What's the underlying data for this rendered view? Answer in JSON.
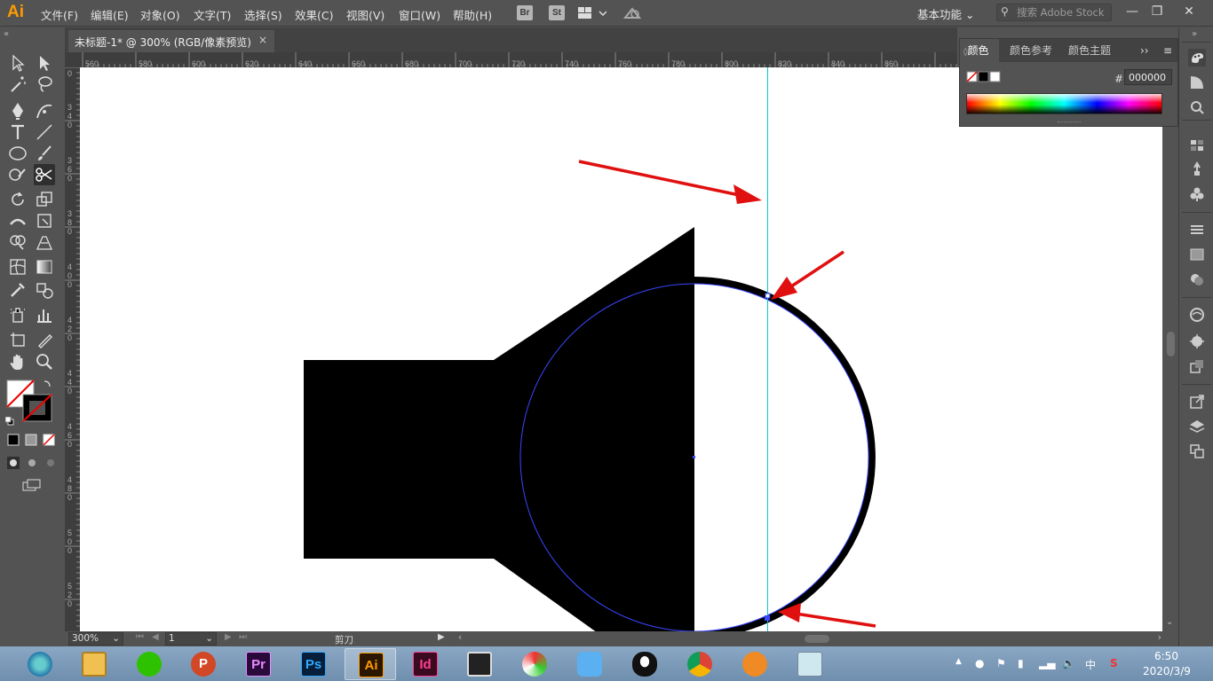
{
  "app": {
    "logo": "Ai"
  },
  "menu": {
    "items": [
      "文件(F)",
      "编辑(E)",
      "对象(O)",
      "文字(T)",
      "选择(S)",
      "效果(C)",
      "视图(V)",
      "窗口(W)",
      "帮助(H)"
    ],
    "bridge": "Br",
    "stock": "St",
    "workspace": "基本功能",
    "search_placeholder": "搜索 Adobe Stock"
  },
  "document": {
    "tab_title": "未标题-1* @ 300% (RGB/像素预览)",
    "close": "×"
  },
  "ruler": {
    "top_labels": [
      "560",
      "580",
      "600",
      "620",
      "640",
      "660",
      "680",
      "700",
      "720",
      "740",
      "760",
      "780",
      "800",
      "820",
      "840",
      "860"
    ],
    "left_labels": [
      "0",
      "340",
      "360",
      "380",
      "400",
      "420",
      "440",
      "460",
      "480",
      "500",
      "520"
    ]
  },
  "statusbar": {
    "zoom": "300%",
    "artboard": "1",
    "current_tool": "剪刀"
  },
  "color_panel": {
    "tabs": [
      "颜色",
      "颜色参考",
      "颜色主题"
    ],
    "hex_label": "#",
    "hex_value": "000000"
  },
  "taskbar": {
    "apps": [
      "360-browser",
      "file-explorer",
      "wechat",
      "powerpoint",
      "premiere",
      "photoshop",
      "illustrator",
      "indesign",
      "video-editor",
      "colorful-app",
      "chat-app",
      "qq",
      "chrome",
      "foxmail",
      "notes"
    ],
    "labels": {
      "powerpoint": "P",
      "premiere": "Pr",
      "photoshop": "Ps",
      "illustrator": "Ai",
      "indesign": "Id"
    },
    "ime": "中",
    "time": "6:50",
    "date": "2020/3/9"
  },
  "colors": {
    "ui_bg": "#535353",
    "guide": "#00c8d8",
    "path": "#3a46ff",
    "arrow": "#e01010",
    "ai_orange": "#ff9a00"
  }
}
